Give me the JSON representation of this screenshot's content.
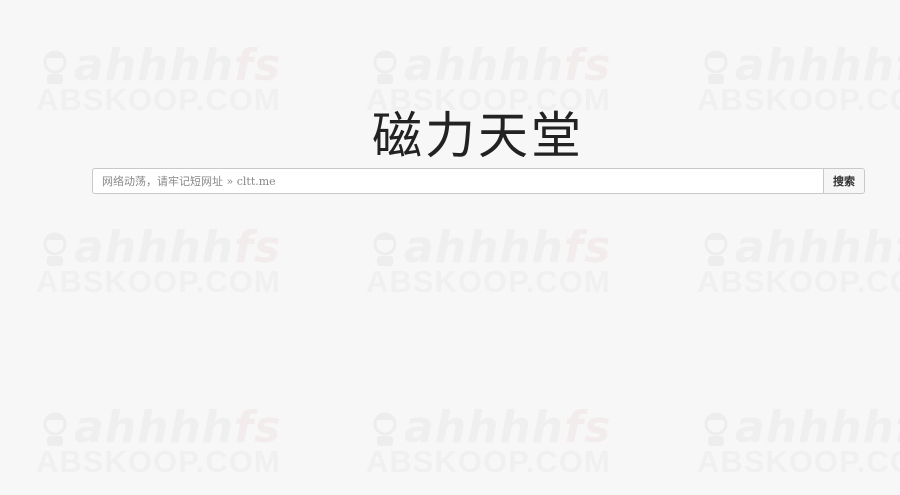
{
  "site": {
    "title": "磁力天堂"
  },
  "search": {
    "placeholder": "网络动荡，请牢记短网址 » cltt.me",
    "value": "",
    "button_label": "搜索"
  },
  "watermark": {
    "script_text_main": "ahhhh",
    "script_text_tail": "fs",
    "domain_text": "ABSKOOP.COM",
    "icon": "cartoon-face-icon"
  },
  "colors": {
    "background": "#f7f7f7",
    "title": "#222222",
    "border": "#c9c9c9",
    "watermark": "#e9e9e9"
  }
}
